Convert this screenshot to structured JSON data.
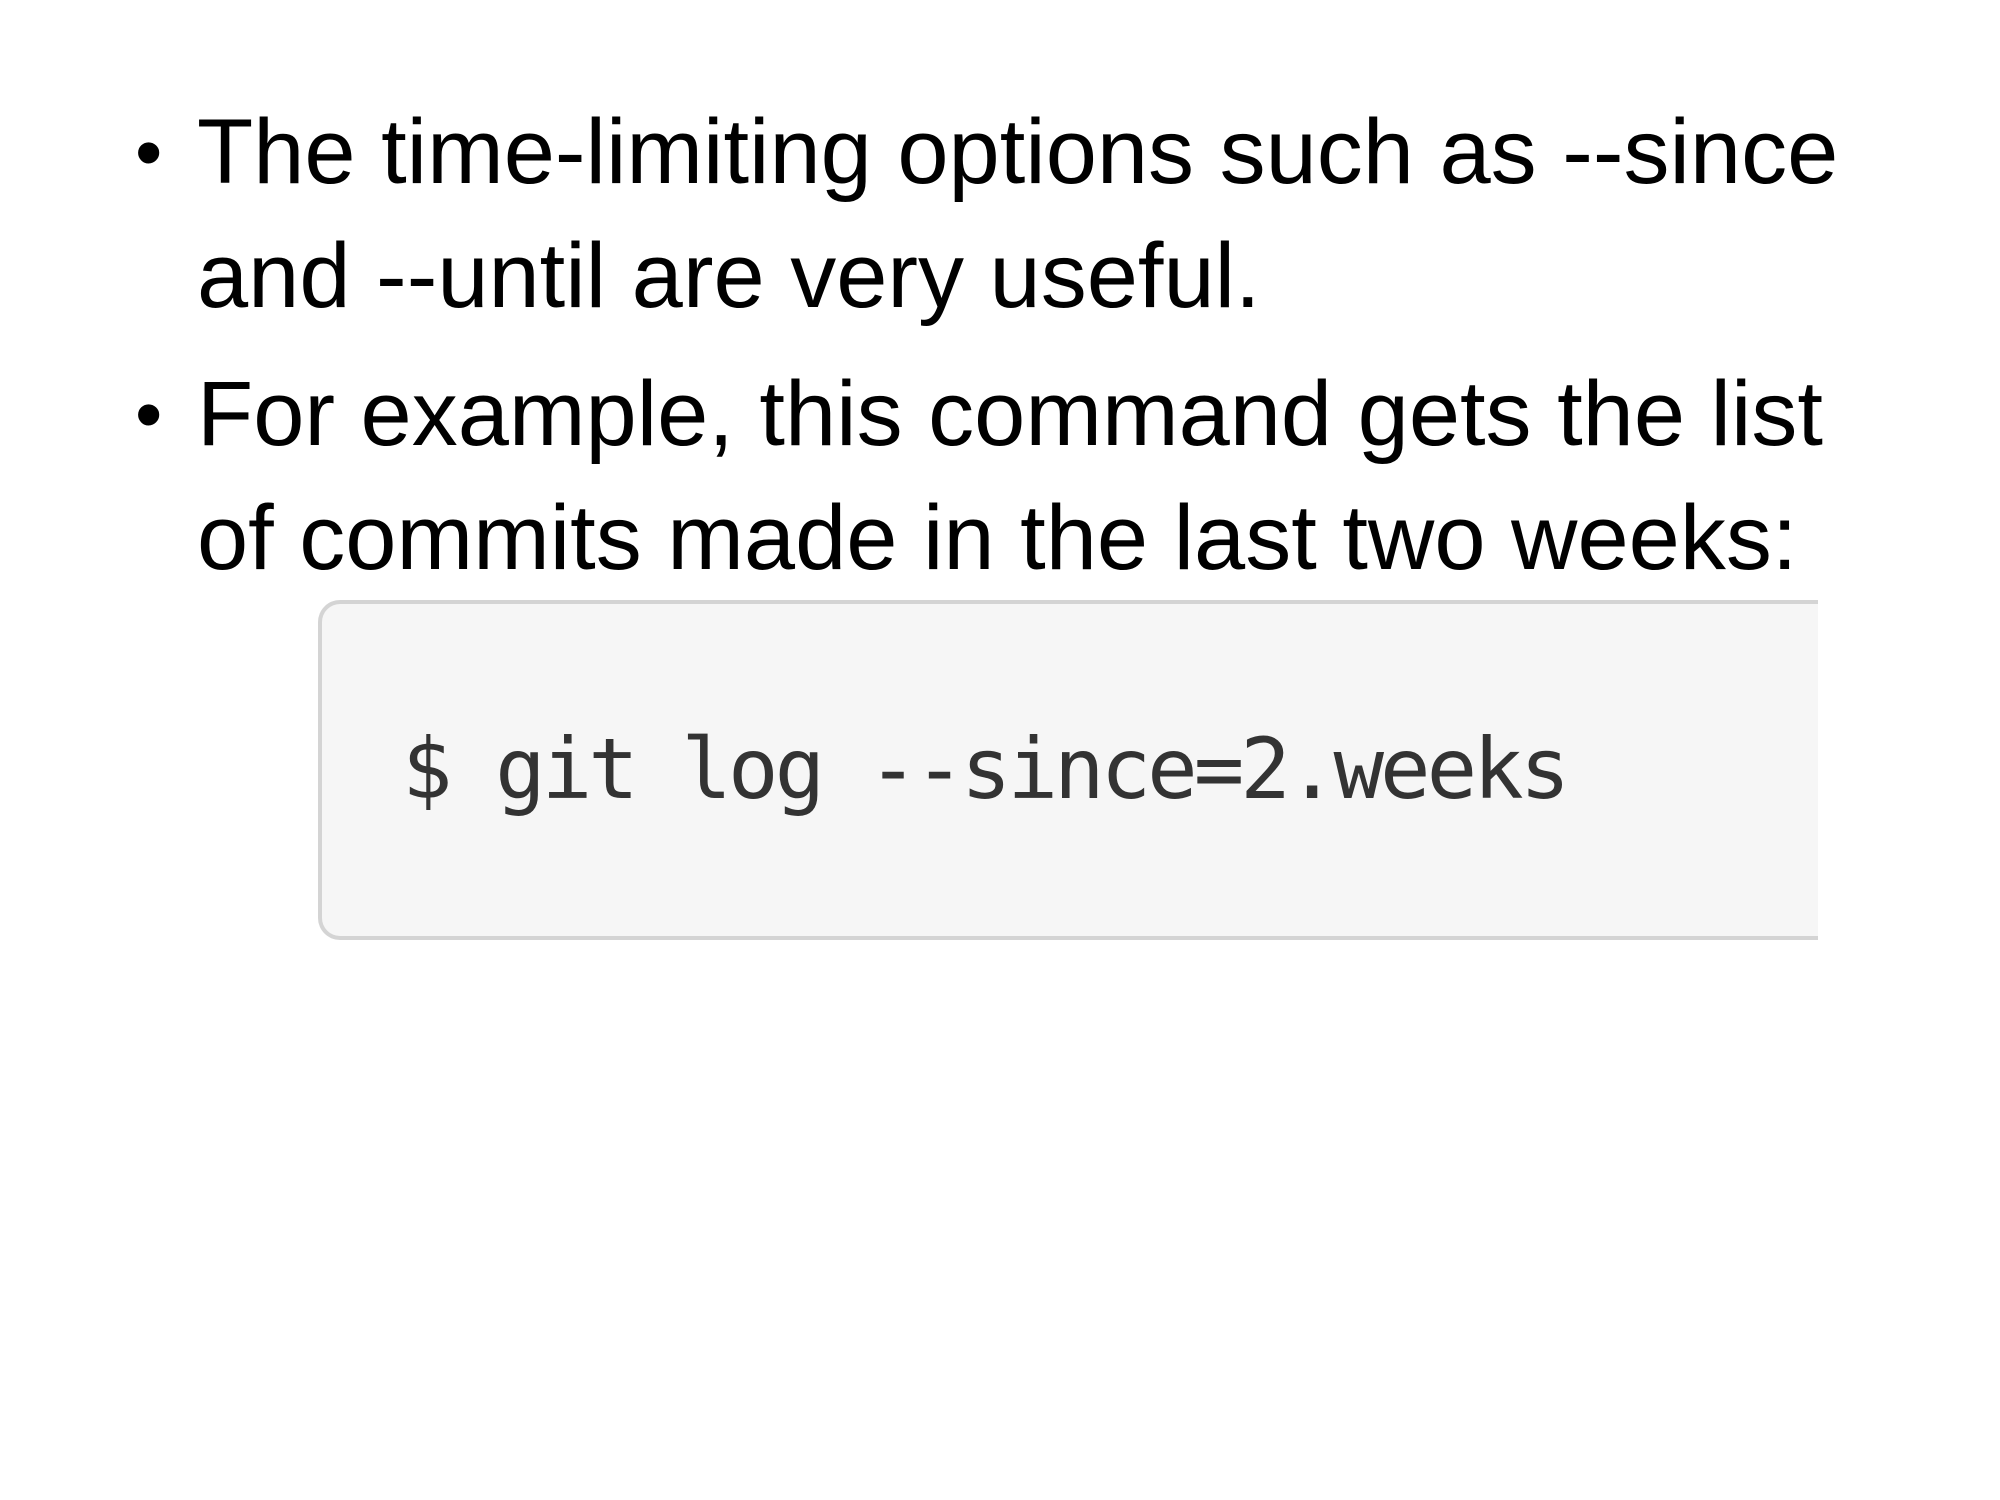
{
  "slide": {
    "bullets": [
      {
        "marker": "•",
        "text": "The time-limiting options such as --since and --until are very useful."
      },
      {
        "marker": "•",
        "text": "For example, this command gets the list of commits made in the last two weeks:"
      }
    ],
    "code": "$ git log --since=2.weeks"
  }
}
